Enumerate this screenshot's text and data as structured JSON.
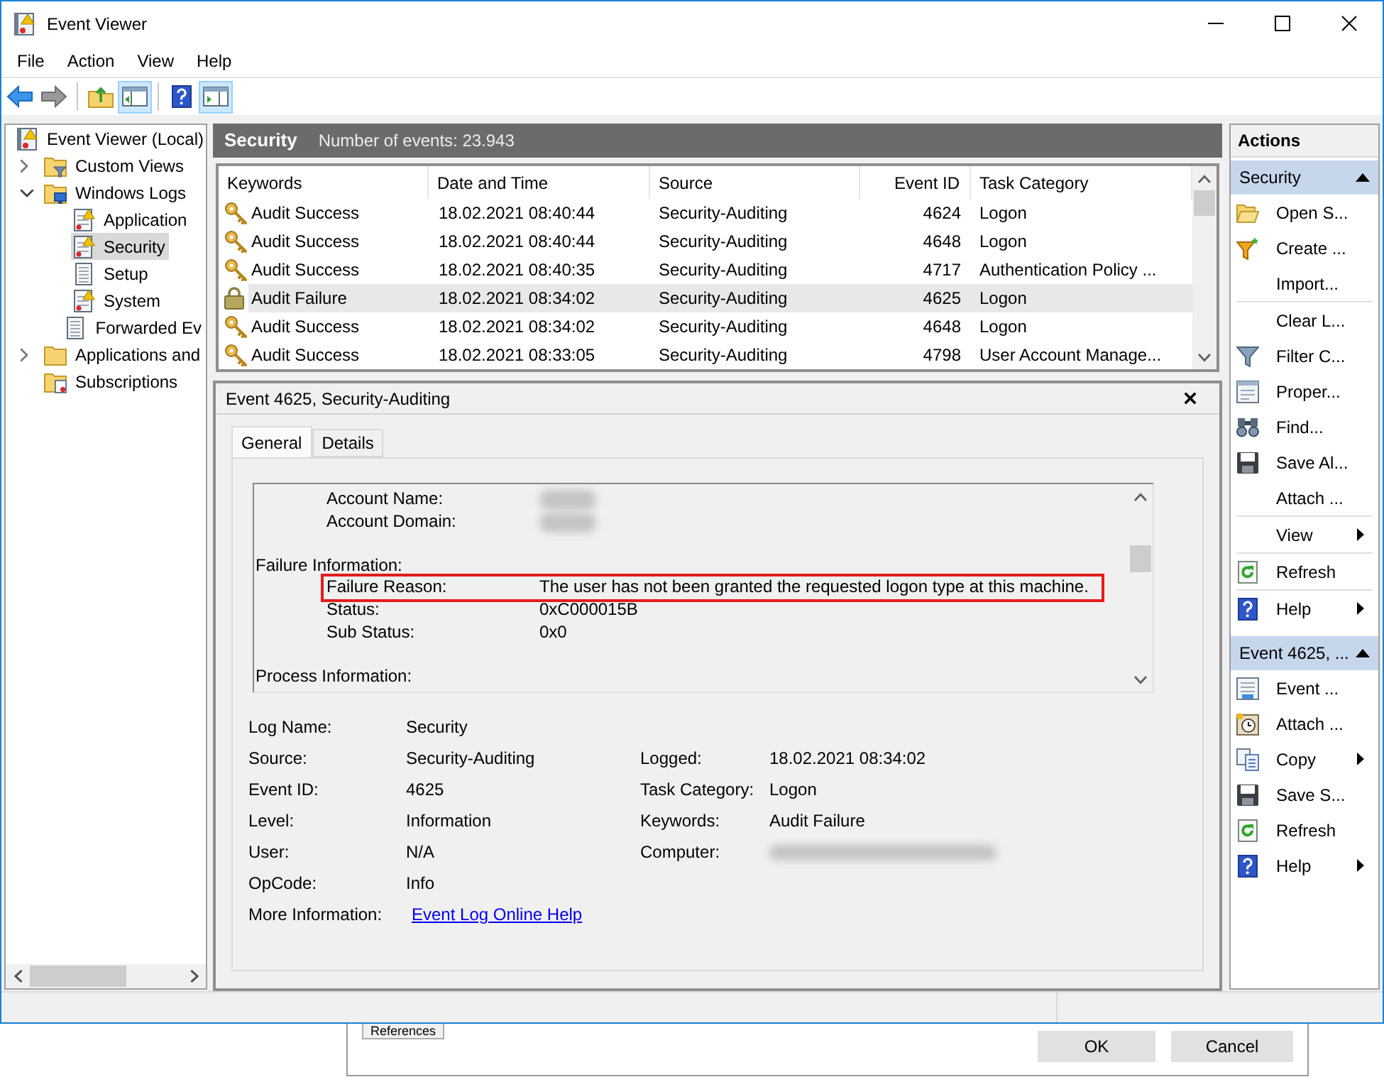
{
  "window": {
    "title": "Event Viewer"
  },
  "menu": [
    "File",
    "Action",
    "View",
    "Help"
  ],
  "toolbar": [
    {
      "kind": "back",
      "pressed": false
    },
    {
      "kind": "forward",
      "pressed": false
    },
    {
      "kind": "separator"
    },
    {
      "kind": "up-folder",
      "pressed": false
    },
    {
      "kind": "tree-toggle",
      "pressed": true
    },
    {
      "kind": "separator"
    },
    {
      "kind": "help",
      "pressed": false
    },
    {
      "kind": "action-pane-toggle",
      "pressed": true
    }
  ],
  "tree": [
    {
      "label": "Event Viewer (Local)",
      "kind": "root",
      "selected": false,
      "children": [
        {
          "label": "Custom Views",
          "kind": "filter-folder",
          "expanded": false,
          "selected": false
        },
        {
          "label": "Windows Logs",
          "kind": "logs-folder",
          "expanded": true,
          "selected": false,
          "children": [
            {
              "label": "Application",
              "kind": "log",
              "selected": false
            },
            {
              "label": "Security",
              "kind": "log",
              "selected": true
            },
            {
              "label": "Setup",
              "kind": "plain-log",
              "selected": false
            },
            {
              "label": "System",
              "kind": "log",
              "selected": false
            },
            {
              "label": "Forwarded Ev",
              "kind": "plain-log",
              "selected": false
            }
          ]
        },
        {
          "label": "Applications and",
          "kind": "folder",
          "expanded": false,
          "selected": false
        },
        {
          "label": "Subscriptions",
          "kind": "subscriptions",
          "selected": false
        }
      ]
    }
  ],
  "log_header": {
    "title": "Security",
    "count": "Number of events: 23.943"
  },
  "events": {
    "columns": [
      "Keywords",
      "Date and Time",
      "Source",
      "Event ID",
      "Task Category"
    ],
    "rows": [
      {
        "kind": "success",
        "keywords": "Audit Success",
        "date": "18.02.2021 08:40:44",
        "source": "Security-Auditing",
        "event_id": "4624",
        "task_category": "Logon",
        "selected": false
      },
      {
        "kind": "success",
        "keywords": "Audit Success",
        "date": "18.02.2021 08:40:44",
        "source": "Security-Auditing",
        "event_id": "4648",
        "task_category": "Logon",
        "selected": false
      },
      {
        "kind": "success",
        "keywords": "Audit Success",
        "date": "18.02.2021 08:40:35",
        "source": "Security-Auditing",
        "event_id": "4717",
        "task_category": "Authentication Policy ...",
        "selected": false
      },
      {
        "kind": "failure",
        "keywords": "Audit Failure",
        "date": "18.02.2021 08:34:02",
        "source": "Security-Auditing",
        "event_id": "4625",
        "task_category": "Logon",
        "selected": true
      },
      {
        "kind": "success",
        "keywords": "Audit Success",
        "date": "18.02.2021 08:34:02",
        "source": "Security-Auditing",
        "event_id": "4648",
        "task_category": "Logon",
        "selected": false
      },
      {
        "kind": "success",
        "keywords": "Audit Success",
        "date": "18.02.2021 08:33:05",
        "source": "Security-Auditing",
        "event_id": "4798",
        "task_category": "User Account Manage...",
        "selected": false
      }
    ]
  },
  "event_detail": {
    "title": "Event 4625, Security-Auditing",
    "tabs": [
      {
        "label": "General",
        "selected": true
      },
      {
        "label": "Details",
        "selected": false
      }
    ],
    "description": [
      {
        "kind": "field",
        "label": "Account Name:",
        "redacted": true
      },
      {
        "kind": "field",
        "label": "Account Domain:",
        "redacted": true
      },
      {
        "kind": "heading",
        "label": "Failure Information:"
      },
      {
        "kind": "field",
        "label": "Failure Reason:",
        "value": "The user has not been granted the requested logon type at this machine.",
        "highlighted": true
      },
      {
        "kind": "field",
        "label": "Status:",
        "value": "0xC000015B"
      },
      {
        "kind": "field",
        "label": "Sub Status:",
        "value": "0x0"
      },
      {
        "kind": "heading",
        "label": "Process Information:"
      }
    ],
    "properties": [
      {
        "left": {
          "label": "Log Name:",
          "value": "Security"
        }
      },
      {
        "left": {
          "label": "Source:",
          "value": "Security-Auditing"
        },
        "right": {
          "label": "Logged:",
          "value": "18.02.2021 08:34:02"
        }
      },
      {
        "left": {
          "label": "Event ID:",
          "value": "4625"
        },
        "right": {
          "label": "Task Category:",
          "value": "Logon"
        }
      },
      {
        "left": {
          "label": "Level:",
          "value": "Information"
        },
        "right": {
          "label": "Keywords:",
          "value": "Audit Failure"
        }
      },
      {
        "left": {
          "label": "User:",
          "value": "N/A"
        },
        "right": {
          "label": "Computer:",
          "redacted": true
        }
      },
      {
        "left": {
          "label": "OpCode:",
          "value": "Info"
        }
      },
      {
        "left": {
          "label": "More Information:",
          "link": "Event Log Online Help"
        }
      }
    ]
  },
  "actions": {
    "title": "Actions",
    "sections": [
      {
        "title": "Security",
        "expanded": true,
        "items": [
          {
            "label": "Open S...",
            "kind": "open",
            "submenu": false,
            "separator_after": false
          },
          {
            "label": "Create ...",
            "kind": "create-view",
            "submenu": false,
            "separator_after": false
          },
          {
            "label": "Import...",
            "kind": "none",
            "submenu": false,
            "separator_after": true
          },
          {
            "label": "Clear L...",
            "kind": "none",
            "submenu": false,
            "separator_after": false
          },
          {
            "label": "Filter C...",
            "kind": "filter",
            "submenu": false,
            "separator_after": false
          },
          {
            "label": "Proper...",
            "kind": "properties",
            "submenu": false,
            "separator_after": false
          },
          {
            "label": "Find...",
            "kind": "find",
            "submenu": false,
            "separator_after": false
          },
          {
            "label": "Save Al...",
            "kind": "save",
            "submenu": false,
            "separator_after": false
          },
          {
            "label": "Attach ...",
            "kind": "none",
            "submenu": false,
            "separator_after": true
          },
          {
            "label": "View",
            "kind": "none",
            "submenu": true,
            "separator_after": true
          },
          {
            "label": "Refresh",
            "kind": "refresh",
            "submenu": false,
            "separator_after": true
          },
          {
            "label": "Help",
            "kind": "help",
            "submenu": true,
            "separator_after": false
          }
        ]
      },
      {
        "title": "Event 4625, ...",
        "expanded": true,
        "items": [
          {
            "label": "Event ...",
            "kind": "event-properties",
            "submenu": false,
            "separator_after": false
          },
          {
            "label": "Attach ...",
            "kind": "attach-task",
            "submenu": false,
            "separator_after": false
          },
          {
            "label": "Copy",
            "kind": "copy",
            "submenu": true,
            "separator_after": false
          },
          {
            "label": "Save S...",
            "kind": "save",
            "submenu": false,
            "separator_after": false
          },
          {
            "label": "Refresh",
            "kind": "refresh",
            "submenu": false,
            "separator_after": false
          },
          {
            "label": "Help",
            "kind": "help",
            "submenu": true,
            "separator_after": false
          }
        ]
      }
    ]
  },
  "dialog": {
    "references": "References",
    "buttons": [
      "OK",
      "Cancel"
    ]
  }
}
